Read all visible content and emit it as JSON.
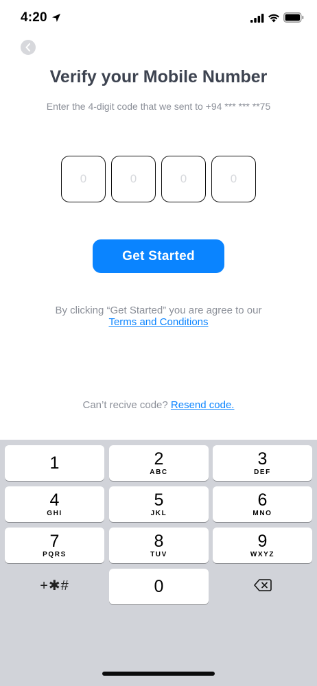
{
  "status_bar": {
    "time": "4:20",
    "icons": [
      "location-arrow-icon",
      "signal-icon",
      "wifi-icon",
      "battery-icon"
    ]
  },
  "header": {
    "back_icon": "chevron-left-icon",
    "title": "Verify your Mobile Number",
    "subtitle": "Enter the 4-digit code that we sent to +94 *** *** **75"
  },
  "code_inputs": {
    "placeholders": [
      "0",
      "0",
      "0",
      "0"
    ],
    "values": [
      "",
      "",
      "",
      ""
    ]
  },
  "actions": {
    "get_started_label": "Get Started",
    "agree_text": "By clicking “Get Started” you are agree to our",
    "terms_label": "Terms and Conditions",
    "resend_prompt": "Can’t recive code?",
    "resend_label": "Resend code."
  },
  "keypad": {
    "keys": [
      {
        "num": "1",
        "letters": ""
      },
      {
        "num": "2",
        "letters": "ABC"
      },
      {
        "num": "3",
        "letters": "DEF"
      },
      {
        "num": "4",
        "letters": "GHI"
      },
      {
        "num": "5",
        "letters": "JKL"
      },
      {
        "num": "6",
        "letters": "MNO"
      },
      {
        "num": "7",
        "letters": "PQRS"
      },
      {
        "num": "8",
        "letters": "TUV"
      },
      {
        "num": "9",
        "letters": "WXYZ"
      },
      {
        "num": "0",
        "letters": ""
      }
    ],
    "symbols_label": "+✱#",
    "delete_icon": "backspace-icon"
  },
  "colors": {
    "accent": "#0a84ff",
    "title": "#3d4350",
    "muted": "#8b8f98",
    "keypad_bg": "#d1d3d9"
  }
}
